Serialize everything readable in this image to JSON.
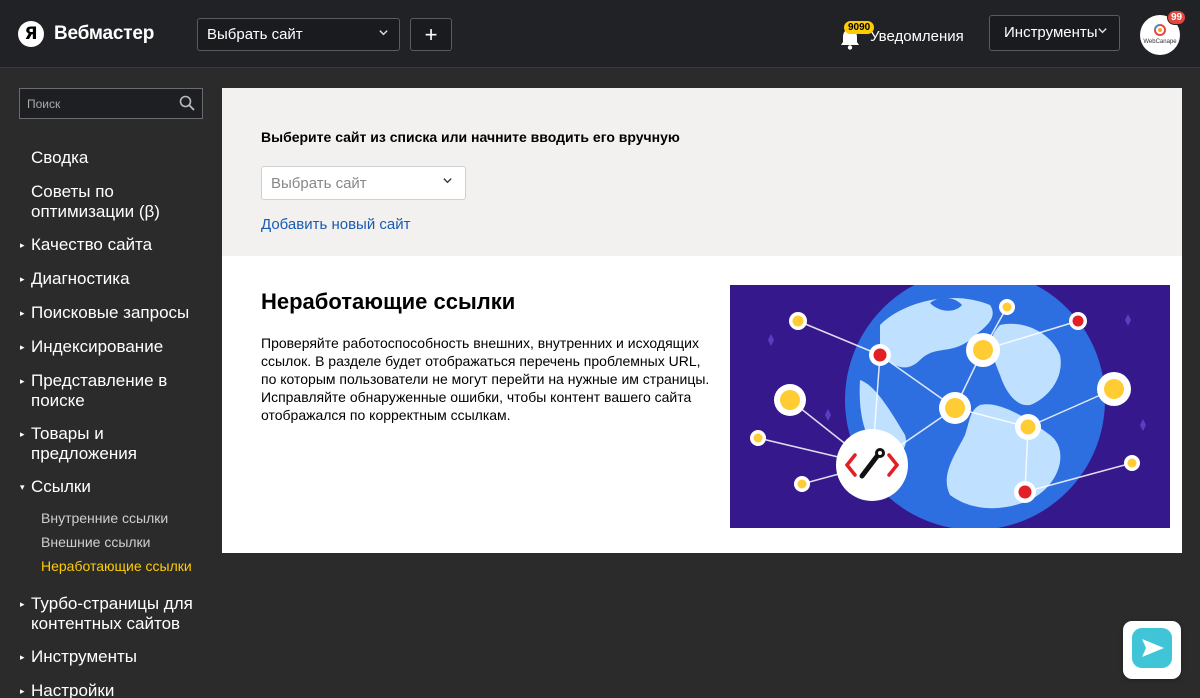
{
  "header": {
    "logo_letter": "Я",
    "logo_text": "Вебмастер",
    "site_select": "Выбрать сайт",
    "add_button": "+",
    "notifications_count": "9090",
    "notifications_label": "Уведомления",
    "tools_label": "Инструменты",
    "avatar_badge": "99",
    "avatar_text": "WebCanape"
  },
  "sidebar": {
    "search_placeholder": "Поиск",
    "items": [
      {
        "label": "Сводка",
        "arrow": ""
      },
      {
        "label": "Советы по оптимизации (β)",
        "arrow": ""
      },
      {
        "label": "Качество сайта",
        "arrow": "▸"
      },
      {
        "label": "Диагностика",
        "arrow": "▸"
      },
      {
        "label": "Поисковые запросы",
        "arrow": "▸"
      },
      {
        "label": "Индексирование",
        "arrow": "▸"
      },
      {
        "label": "Представление в поиске",
        "arrow": "▸"
      },
      {
        "label": "Товары и предложения",
        "arrow": "▸"
      },
      {
        "label": "Ссылки",
        "arrow": "▾"
      },
      {
        "label": "Турбо-страницы для контентных сайтов",
        "arrow": "▸"
      },
      {
        "label": "Инструменты",
        "arrow": "▸"
      },
      {
        "label": "Настройки",
        "arrow": "▸"
      }
    ],
    "sub_items": [
      {
        "label": "Внутренние ссылки"
      },
      {
        "label": "Внешние ссылки"
      },
      {
        "label": "Неработающие ссылки"
      }
    ]
  },
  "select_panel": {
    "heading": "Выберите сайт из списка или начните вводить его вручную",
    "select_placeholder": "Выбрать сайт",
    "add_link": "Добавить новый сайт"
  },
  "info_panel": {
    "title": "Неработающие ссылки",
    "description": "Проверяйте работоспособность внешних, внутренних и исходящих ссылок. В разделе будет отображаться перечень проблемных URL, по которым пользователи не могут перейти на нужные им страницы. Исправляйте обнаруженные ошибки, чтобы контент вашего сайта отображался по корректным ссылкам."
  },
  "colors": {
    "accent_yellow": "#ffcc00",
    "link_blue": "#1a5ab3",
    "illustration_bg": "#35198c",
    "badge_red": "#e8453c"
  }
}
